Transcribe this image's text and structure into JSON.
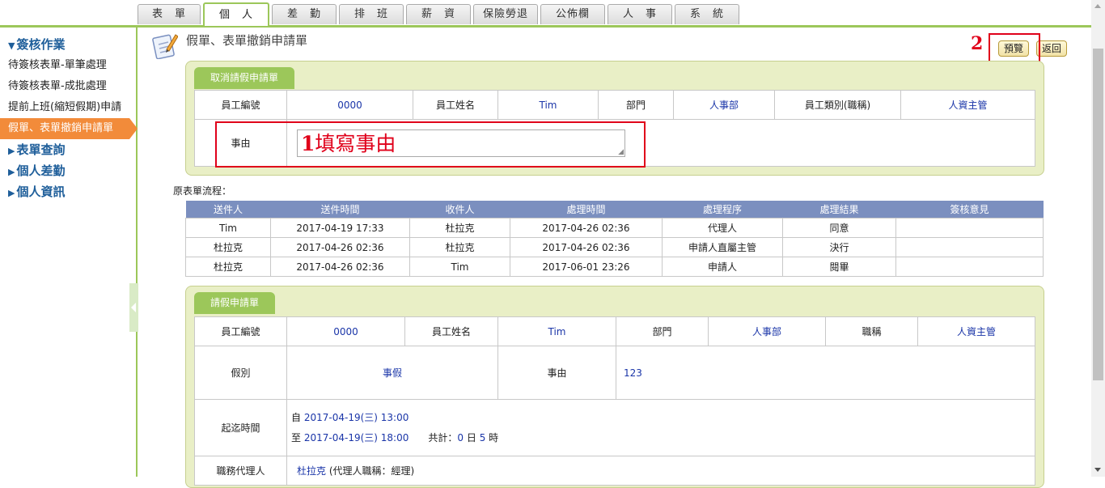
{
  "top_tabs": [
    "表　單",
    "個　人",
    "差　勤",
    "排　班",
    "薪　資",
    "保險勞退",
    "公佈欄",
    "人　事",
    "系　統"
  ],
  "active_tab": 1,
  "sidebar": {
    "sections": [
      {
        "label": "簽核作業",
        "expanded": true,
        "items": [
          "待簽核表單-單筆處理",
          "待簽核表單-成批處理",
          "提前上班(縮短假期)申請",
          "假單、表單撤銷申請單"
        ]
      },
      {
        "label": "表單查詢",
        "expanded": false
      },
      {
        "label": "個人差勤",
        "expanded": false
      },
      {
        "label": "個人資訊",
        "expanded": false
      }
    ]
  },
  "page_title": "假單、表單撤銷申請單",
  "buttons": {
    "preview": "預覽",
    "back": "返回"
  },
  "annotations": {
    "step1": "1",
    "step1_text": "填寫事由",
    "step2": "2"
  },
  "cancel_panel": {
    "tab": "取消請假申請單",
    "labels": {
      "emp_no": "員工編號",
      "emp_name": "員工姓名",
      "dept": "部門",
      "emp_type": "員工類別(職稱)",
      "reason": "事由"
    },
    "values": {
      "emp_no": "0000",
      "emp_name": "Tim",
      "dept": "人事部",
      "emp_type": "人資主管",
      "reason": ""
    }
  },
  "flow": {
    "label": "原表單流程：",
    "headers": [
      "送件人",
      "送件時間",
      "收件人",
      "處理時間",
      "處理程序",
      "處理結果",
      "簽核意見"
    ],
    "rows": [
      [
        "Tim",
        "2017-04-19 17:33",
        "杜拉克",
        "2017-04-26 02:36",
        "代理人",
        "同意",
        ""
      ],
      [
        "杜拉克",
        "2017-04-26 02:36",
        "杜拉克",
        "2017-04-26 02:36",
        "申請人直屬主管",
        "決行",
        ""
      ],
      [
        "杜拉克",
        "2017-04-26 02:36",
        "Tim",
        "2017-06-01 23:26",
        "申請人",
        "閱畢",
        ""
      ]
    ]
  },
  "leave_panel": {
    "tab": "請假申請單",
    "labels": {
      "emp_no": "員工編號",
      "emp_name": "員工姓名",
      "dept": "部門",
      "title": "職稱",
      "leave_type": "假別",
      "reason": "事由",
      "period": "起迄時間",
      "agent": "職務代理人"
    },
    "values": {
      "emp_no": "0000",
      "emp_name": "Tim",
      "dept": "人事部",
      "title": "人資主管",
      "leave_type": "事假",
      "reason": "123",
      "from_prefix": "自",
      "from": "2017-04-19(三) 13:00",
      "to_prefix": "至",
      "to": "2017-04-19(三) 18:00",
      "total_label": "共計：",
      "days": "0",
      "day_unit": "日",
      "hours": "5",
      "hour_unit": "時",
      "agent": "杜拉克",
      "agent_title": "(代理人職稱：經理)"
    }
  },
  "colors": {
    "accent_green": "#9cc75a",
    "active_orange": "#f28b3a",
    "link_blue": "#1a35a8",
    "annotation_red": "#e0001a"
  }
}
